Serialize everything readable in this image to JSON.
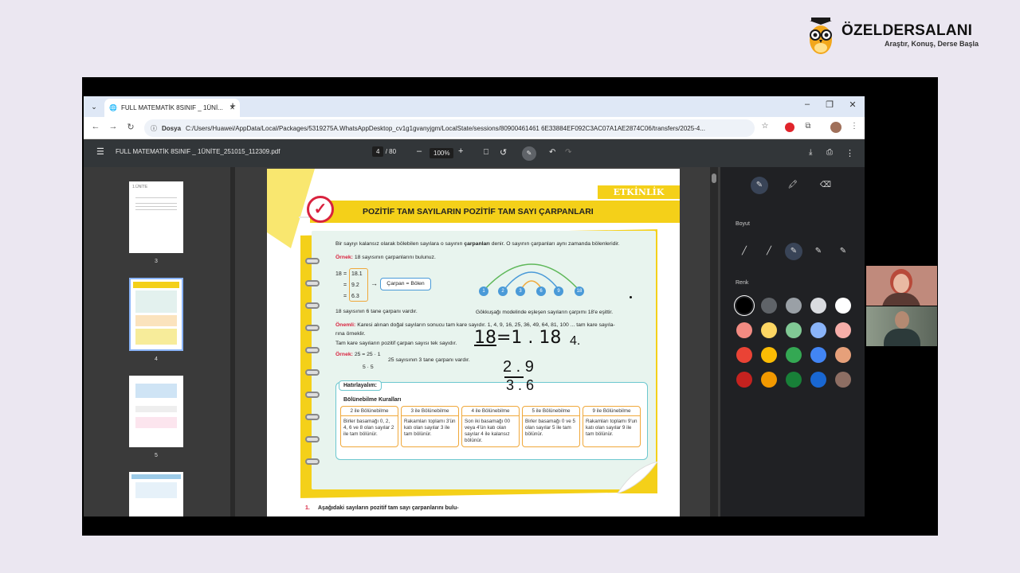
{
  "brand": {
    "name": "ÖZELDERSALANI",
    "tagline": "Araştır, Konuş, Derse Başla"
  },
  "browser": {
    "tab_title": "FULL MATEMATİK 8SINIF _ 1ÜNİ...",
    "tab_close": "✕",
    "new_tab": "+",
    "tab_dropdown": "⌄",
    "win_min": "–",
    "win_max": "❐",
    "win_close": "✕",
    "nav_back": "←",
    "nav_forward": "→",
    "nav_reload": "↻",
    "site_info": "ⓘ",
    "dosya_label": "Dosya",
    "url": "C:/Users/Huawei/AppData/Local/Packages/5319275A.WhatsAppDesktop_cv1g1gvanyjgm/LocalState/sessions/80900461461 6E33884EF092C3AC07A1AE2874C06/transfers/2025-4...",
    "star": "☆",
    "menu": "⋮"
  },
  "pdf_toolbar": {
    "menu": "☰",
    "filename": "FULL MATEMATİK 8SINIF _ 1ÜNİTE_251015_112309.pdf",
    "current_page": "4",
    "page_sep": "/",
    "total_pages": "80",
    "zoom_out": "–",
    "zoom": "100%",
    "zoom_in": "+",
    "fit": "⎕",
    "rotate": "↺",
    "annotate": "✎",
    "undo": "↶",
    "redo": "↷",
    "download": "⤓",
    "print": "⎙",
    "more": "⋮"
  },
  "thumbnails": [
    {
      "number": "3",
      "header": "1.ÜNİTE"
    },
    {
      "number": "4",
      "selected": true
    },
    {
      "number": "5"
    },
    {
      "number": ""
    }
  ],
  "page": {
    "etkinlik": "ETKİNLİK",
    "title": "POZİTİF TAM SAYILARIN POZİTİF TAM SAYI ÇARPANLARI",
    "intro_a": "Bir sayıyı kalansız olarak bölebilen sayılara o sayının ",
    "intro_b": "çarpanları",
    "intro_c": " denir. O sayının çarpanları aynı zamanda bölenleridir.",
    "ornek1_label": "Örnek:",
    "ornek1_text": "18 sayısının çarpanlarını bulunuz.",
    "eq_18": "18",
    "eq_line1": "18.1",
    "eq_line2": "9.2",
    "eq_line3": "6.3",
    "eq_eq": "=",
    "arrow": "→",
    "carpan_bolen": "Çarpan = Bölen",
    "rainbow_numbers": [
      "1",
      "2",
      "3",
      "6",
      "9",
      "18"
    ],
    "rainbow_caption": "Gökkuşağı modelinde eşleşen sayıların çarpımı 18'e eşittir.",
    "six_factors": "18 sayısının 6 tane çarpanı vardır.",
    "onemli_label": "Önemli:",
    "onemli_text": "Karesi alınan doğal sayıların sonucu tam kare sayıdır. 1, 4, 9, 16, 25, 36, 49, 64, 81, 100 ... tam kare sayıla-",
    "onemli_text2": "rına örneklir.",
    "odd_text": "Tam kare sayıların pozitif çarpan sayısı tek sayıdır.",
    "ornek2_label": "Örnek:",
    "ornek2_eq": "25 = 25 · 1",
    "ornek2_eq2": "5 · 5",
    "ornek2_text": "25 sayısının 3 tane çarpanı vardır.",
    "hatirlayalim": "Hatırlayalım:",
    "bolunebilme_title": "Bölünebilme Kuralları",
    "rules": [
      {
        "header": "2 ile Bölünebilme",
        "body": "Birler basamağı 0, 2, 4, 6 ve 8 olan sayılar 2 ile tam bölünür."
      },
      {
        "header": "3 ile Bölünebilme",
        "body": "Rakamları toplamı 3'ün katı olan sayılar 3 ile tam bölünür."
      },
      {
        "header": "4 ile Bölünebilme",
        "body": "Son iki basamağı 00 veya 4'ün katı olan sayılar 4 ile kalansız bölünür."
      },
      {
        "header": "5 ile Bölünebilme",
        "body": "Birler basamağı 0 ve 5 olan sayılar 5 ile tam bölünür."
      },
      {
        "header": "9 ile Bölünebilme",
        "body": "Rakamları toplamı 9'un katı olan sayılar 9 ile tam bölünür."
      }
    ],
    "question_number": "1.",
    "question_text": "Aşağıdaki sayıların pozitif tam sayı çarpanlarını bulu-",
    "handwriting": {
      "l1a": "18",
      "l1b": "=1 . 18",
      "l1c": "4.",
      "l2": "2 . 9",
      "l3": "3 . 6"
    }
  },
  "annot_panel": {
    "boyut_label": "Boyut",
    "renk_label": "Renk",
    "tools": [
      "pen",
      "highlighter",
      "eraser"
    ],
    "colors": [
      "#000000",
      "#5f6368",
      "#9aa0a6",
      "#dadce0",
      "#ffffff",
      "#f28b82",
      "#fdd663",
      "#81c995",
      "#8ab4f8",
      "#f6aea9",
      "#ea4335",
      "#fbbc04",
      "#34a853",
      "#4285f4",
      "#e6a07a",
      "#c5221f",
      "#f29900",
      "#188038",
      "#1967d2",
      "#8d6e63"
    ]
  },
  "colors": {
    "accent_blue": "#4a9ad8",
    "yellow": "#f4d019",
    "orange": "#f0a83a",
    "red": "#d9223e",
    "teal": "#6cc7cf"
  }
}
